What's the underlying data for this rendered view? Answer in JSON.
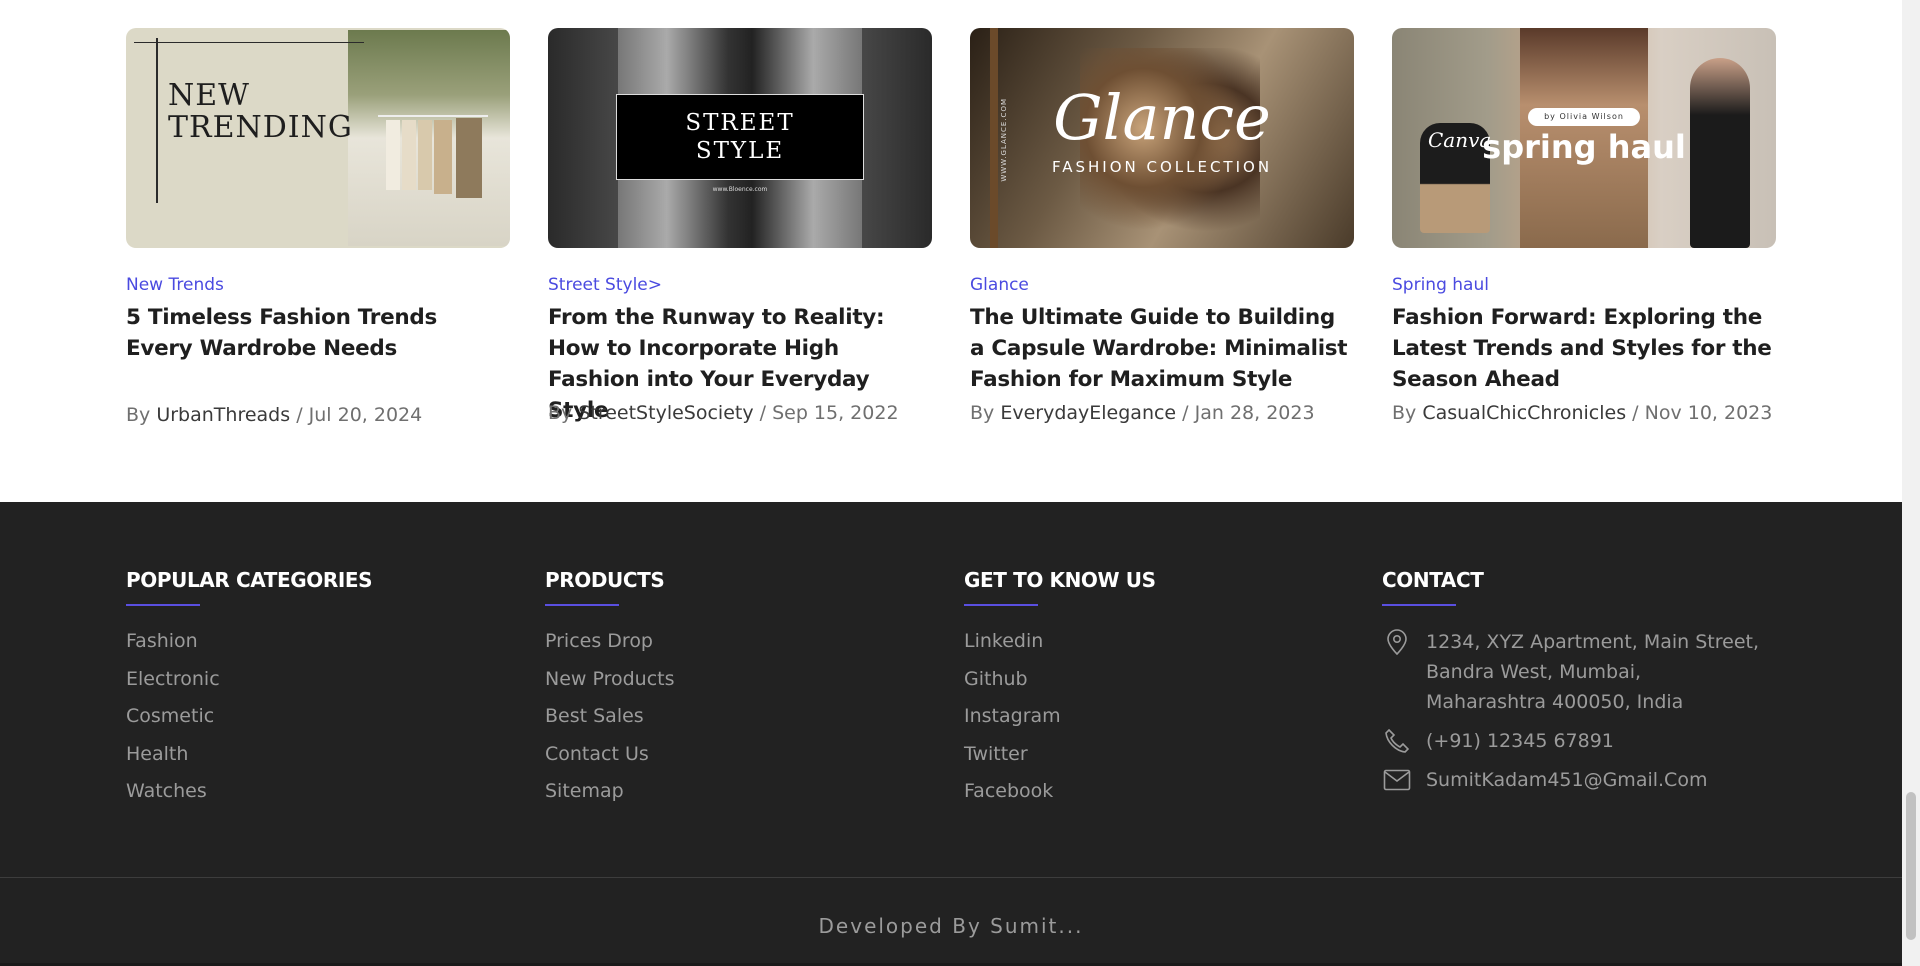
{
  "blog": {
    "cards": [
      {
        "tag": "New Trends",
        "title": "5 Timeless Fashion Trends Every Wardrobe Needs",
        "by": "By",
        "author": "UrbanThreads",
        "sep": "/",
        "date": "Jul 20, 2024",
        "image_text": "NEW\nTRENDING"
      },
      {
        "tag": "Street Style>",
        "title": "From the Runway to Reality: How to Incorporate High Fashion into Your Everyday Style",
        "by": "By",
        "author": "StreetStyleSociety",
        "sep": "/",
        "date": "Sep 15, 2022",
        "image_text": "STREET\nSTYLE",
        "image_small": "www.Bloence.com"
      },
      {
        "tag": "Glance",
        "title": "The Ultimate Guide to Building a Capsule Wardrobe: Minimalist Fashion for Maximum Style",
        "by": "By",
        "author": "EverydayElegance",
        "sep": "/",
        "date": "Jan 28, 2023",
        "image_text": "Glance",
        "image_sub": "FASHION COLLECTION",
        "image_side": "WWW.GLANCE.COM"
      },
      {
        "tag": "Spring haul",
        "title": "Fashion Forward: Exploring the Latest Trends and Styles for the Season Ahead",
        "by": "By",
        "author": "CasualChicChronicles",
        "sep": "/",
        "date": "Nov 10, 2023",
        "image_text": "spring haul",
        "image_pill": "by Olivia Wilson",
        "image_script": "Canva"
      }
    ]
  },
  "footer": {
    "columns": [
      {
        "title": "POPULAR CATEGORIES",
        "items": [
          "Fashion",
          "Electronic",
          "Cosmetic",
          "Health",
          "Watches"
        ]
      },
      {
        "title": "PRODUCTS",
        "items": [
          "Prices Drop",
          "New Products",
          "Best Sales",
          "Contact Us",
          "Sitemap"
        ]
      },
      {
        "title": "GET TO KNOW US",
        "items": [
          "Linkedin",
          "Github",
          "Instagram",
          "Twitter",
          "Facebook"
        ]
      }
    ],
    "contact": {
      "title": "CONTACT",
      "address_line1": "1234, XYZ Apartment, Main Street,",
      "address_line2": "Bandra West, Mumbai,",
      "address_line3": "Maharashtra 400050, India",
      "phone": "(+91) 12345 67891",
      "email": "SumitKadam451@Gmail.Com",
      "icons": [
        "location-pin-icon",
        "phone-icon",
        "mail-icon"
      ]
    },
    "copyright": "Developed By Sumit..."
  },
  "colors": {
    "accent": "#4a4ae0",
    "footer_bg": "#222222",
    "underline": "#5a4fe0",
    "muted_text": "#9b9b9b"
  }
}
